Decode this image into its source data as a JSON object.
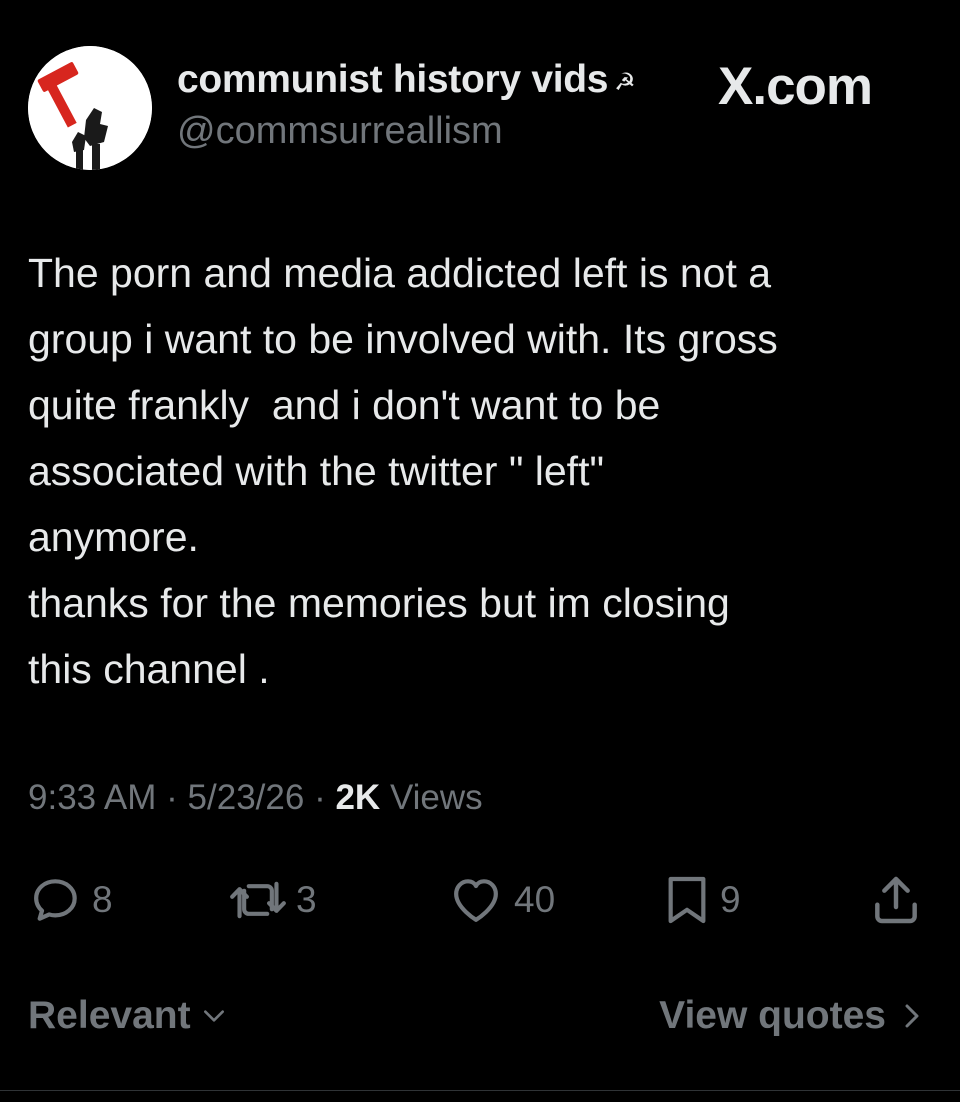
{
  "header": {
    "display_name": "communist history vids",
    "name_badge": "☭",
    "handle": "@commsurreallism",
    "brand": "X.com"
  },
  "tweet": {
    "text": "The porn and media addicted left is not a\ngroup i want to be involved with. Its gross\nquite frankly  and i don't want to be\nassociated with the twitter \" left\"\nanymore.\nthanks for the memories but im closing\nthis channel ."
  },
  "meta": {
    "time": "9:33 AM",
    "separator": "·",
    "date": "5/23/26",
    "views_count": "2K",
    "views_label": "Views"
  },
  "actions": {
    "replies": "8",
    "reposts": "3",
    "likes": "40",
    "bookmarks": "9"
  },
  "footer": {
    "sort_label": "Relevant",
    "view_quotes_label": "View quotes"
  },
  "colors": {
    "background": "#000000",
    "text_primary": "#e7e9ea",
    "text_secondary": "#71767b",
    "avatar_red": "#d7261e"
  }
}
